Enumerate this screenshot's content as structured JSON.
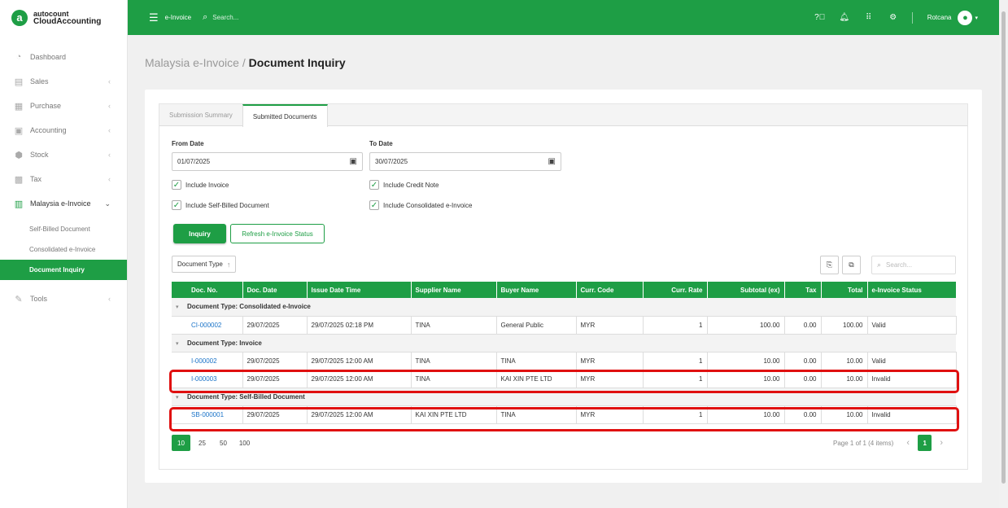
{
  "brand": {
    "top": "autocount",
    "bottom": "CloudAccounting",
    "logo_letter": "a"
  },
  "topbar": {
    "title": "e-Invoice",
    "search_placeholder": "Search...",
    "user": "Rotcana",
    "accent": "#1e9e45"
  },
  "sidebar": {
    "items": [
      {
        "label": "Dashboard",
        "icon": "dashboard-icon"
      },
      {
        "label": "Sales",
        "icon": "sales-icon"
      },
      {
        "label": "Purchase",
        "icon": "purchase-icon"
      },
      {
        "label": "Accounting",
        "icon": "accounting-icon"
      },
      {
        "label": "Stock",
        "icon": "stock-icon"
      },
      {
        "label": "Tax",
        "icon": "tax-icon"
      },
      {
        "label": "Malaysia e-Invoice",
        "icon": "einvoice-icon"
      },
      {
        "label": "Tools",
        "icon": "tools-icon"
      }
    ],
    "sub_items": [
      "Self-Billed Document",
      "Consolidated e-Invoice",
      "Document Inquiry"
    ]
  },
  "breadcrumb": {
    "parent": "Malaysia e-Invoice /",
    "current": "Document Inquiry"
  },
  "tabs": [
    "Submission Summary",
    "Submitted Documents"
  ],
  "form": {
    "from_label": "From Date",
    "from_value": "01/07/2025",
    "to_label": "To Date",
    "to_value": "30/07/2025",
    "checks": [
      "Include Invoice",
      "Include Credit Note",
      "Include Self-Billed Document",
      "Include Consolidated e-Invoice"
    ],
    "inquiry_label": "Inquiry",
    "refresh_label": "Refresh e-Invoice Status"
  },
  "grid": {
    "group_by": "Document Type",
    "search_placeholder": "Search...",
    "columns": [
      "Doc. No.",
      "Doc. Date",
      "Issue Date Time",
      "Supplier Name",
      "Buyer Name",
      "Curr. Code",
      "Curr. Rate",
      "Subtotal (ex)",
      "Tax",
      "Total",
      "e-Invoice Status"
    ],
    "groups": [
      {
        "title": "Document Type: Consolidated e-Invoice",
        "rows": [
          [
            "CI-000002",
            "29/07/2025",
            "29/07/2025 02:18 PM",
            "TINA",
            "General Public",
            "MYR",
            "1",
            "100.00",
            "0.00",
            "100.00",
            "Valid"
          ]
        ]
      },
      {
        "title": "Document Type: Invoice",
        "rows": [
          [
            "I-000002",
            "29/07/2025",
            "29/07/2025 12:00 AM",
            "TINA",
            "TINA",
            "MYR",
            "1",
            "10.00",
            "0.00",
            "10.00",
            "Valid"
          ],
          [
            "I-000003",
            "29/07/2025",
            "29/07/2025 12:00 AM",
            "TINA",
            "KAI XIN PTE LTD",
            "MYR",
            "1",
            "10.00",
            "0.00",
            "10.00",
            "Invalid"
          ]
        ]
      },
      {
        "title": "Document Type: Self-Billed Document",
        "rows": [
          [
            "SB-000001",
            "29/07/2025",
            "29/07/2025 12:00 AM",
            "KAI XIN PTE LTD",
            "TINA",
            "MYR",
            "1",
            "10.00",
            "0.00",
            "10.00",
            "Invalid"
          ]
        ]
      }
    ]
  },
  "pager": {
    "sizes": [
      "10",
      "25",
      "50",
      "100"
    ],
    "info": "Page 1 of 1 (4 items)",
    "current": "1"
  }
}
